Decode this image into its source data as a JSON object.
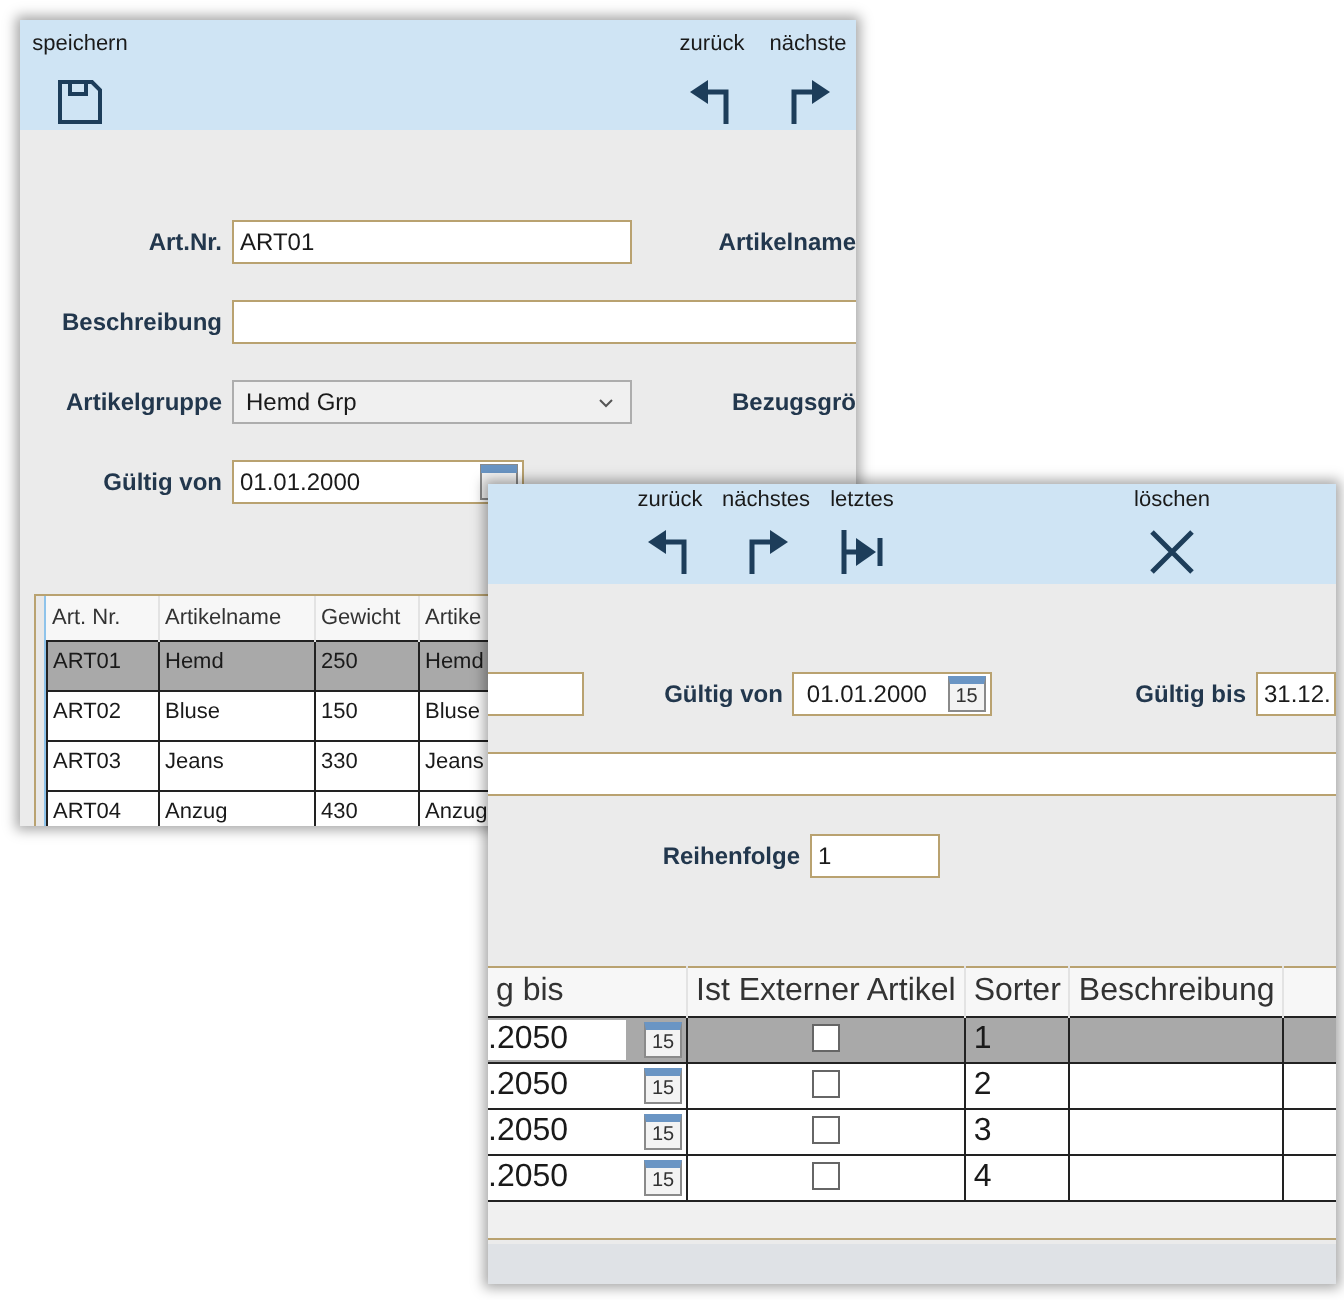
{
  "back_window": {
    "toolbar": {
      "left": [
        {
          "label": "speichern",
          "kind": "save"
        }
      ],
      "right": [
        {
          "label": "zurück",
          "kind": "back"
        },
        {
          "label": "nächste",
          "kind": "next"
        }
      ]
    },
    "form": {
      "art_nr": {
        "label": "Art.Nr.",
        "value": "ART01"
      },
      "artikelname": {
        "label": "Artikelname"
      },
      "beschreibung": {
        "label": "Beschreibung"
      },
      "artikelgruppe": {
        "label": "Artikelgruppe",
        "value": "Hemd Grp"
      },
      "bezugsgroesse": {
        "label": "Bezugsgrö"
      },
      "gueltig_von": {
        "label": "Gültig von",
        "value": "01.01.2000"
      }
    },
    "table": {
      "columns": [
        "Art. Nr.",
        "Artikelname",
        "Gewicht",
        "Artike"
      ],
      "rows": [
        {
          "cells": [
            "ART01",
            "Hemd",
            "250",
            "Hemd"
          ],
          "selected": true
        },
        {
          "cells": [
            "ART02",
            "Bluse",
            "150",
            "Bluse"
          ],
          "selected": false
        },
        {
          "cells": [
            "ART03",
            "Jeans",
            "330",
            "Jeans"
          ],
          "selected": false
        },
        {
          "cells": [
            "ART04",
            "Anzug",
            "430",
            "Anzug"
          ],
          "selected": false
        }
      ]
    }
  },
  "front_window": {
    "toolbar": [
      {
        "label": "zurück",
        "kind": "back"
      },
      {
        "label": "nächstes",
        "kind": "next"
      },
      {
        "label": "letztes",
        "kind": "last"
      },
      {
        "label": "löschen",
        "kind": "delete"
      }
    ],
    "form": {
      "gueltig_von": {
        "label": "Gültig von",
        "value": "01.01.2000",
        "calendar": "15"
      },
      "gueltig_bis": {
        "label": "Gültig bis",
        "value": "31.12."
      },
      "reihenfolge": {
        "label": "Reihenfolge",
        "value": "1"
      }
    },
    "table": {
      "columns": [
        "g bis",
        "Ist Externer Artikel",
        "Sorter",
        "Beschreibung"
      ],
      "rows": [
        {
          "date": ".2050",
          "calendar": "15",
          "external": false,
          "sorter": "1",
          "selected": true
        },
        {
          "date": ".2050",
          "calendar": "15",
          "external": false,
          "sorter": "2",
          "selected": false
        },
        {
          "date": ".2050",
          "calendar": "15",
          "external": false,
          "sorter": "3",
          "selected": false
        },
        {
          "date": ".2050",
          "calendar": "15",
          "external": false,
          "sorter": "4",
          "selected": false
        }
      ]
    }
  }
}
